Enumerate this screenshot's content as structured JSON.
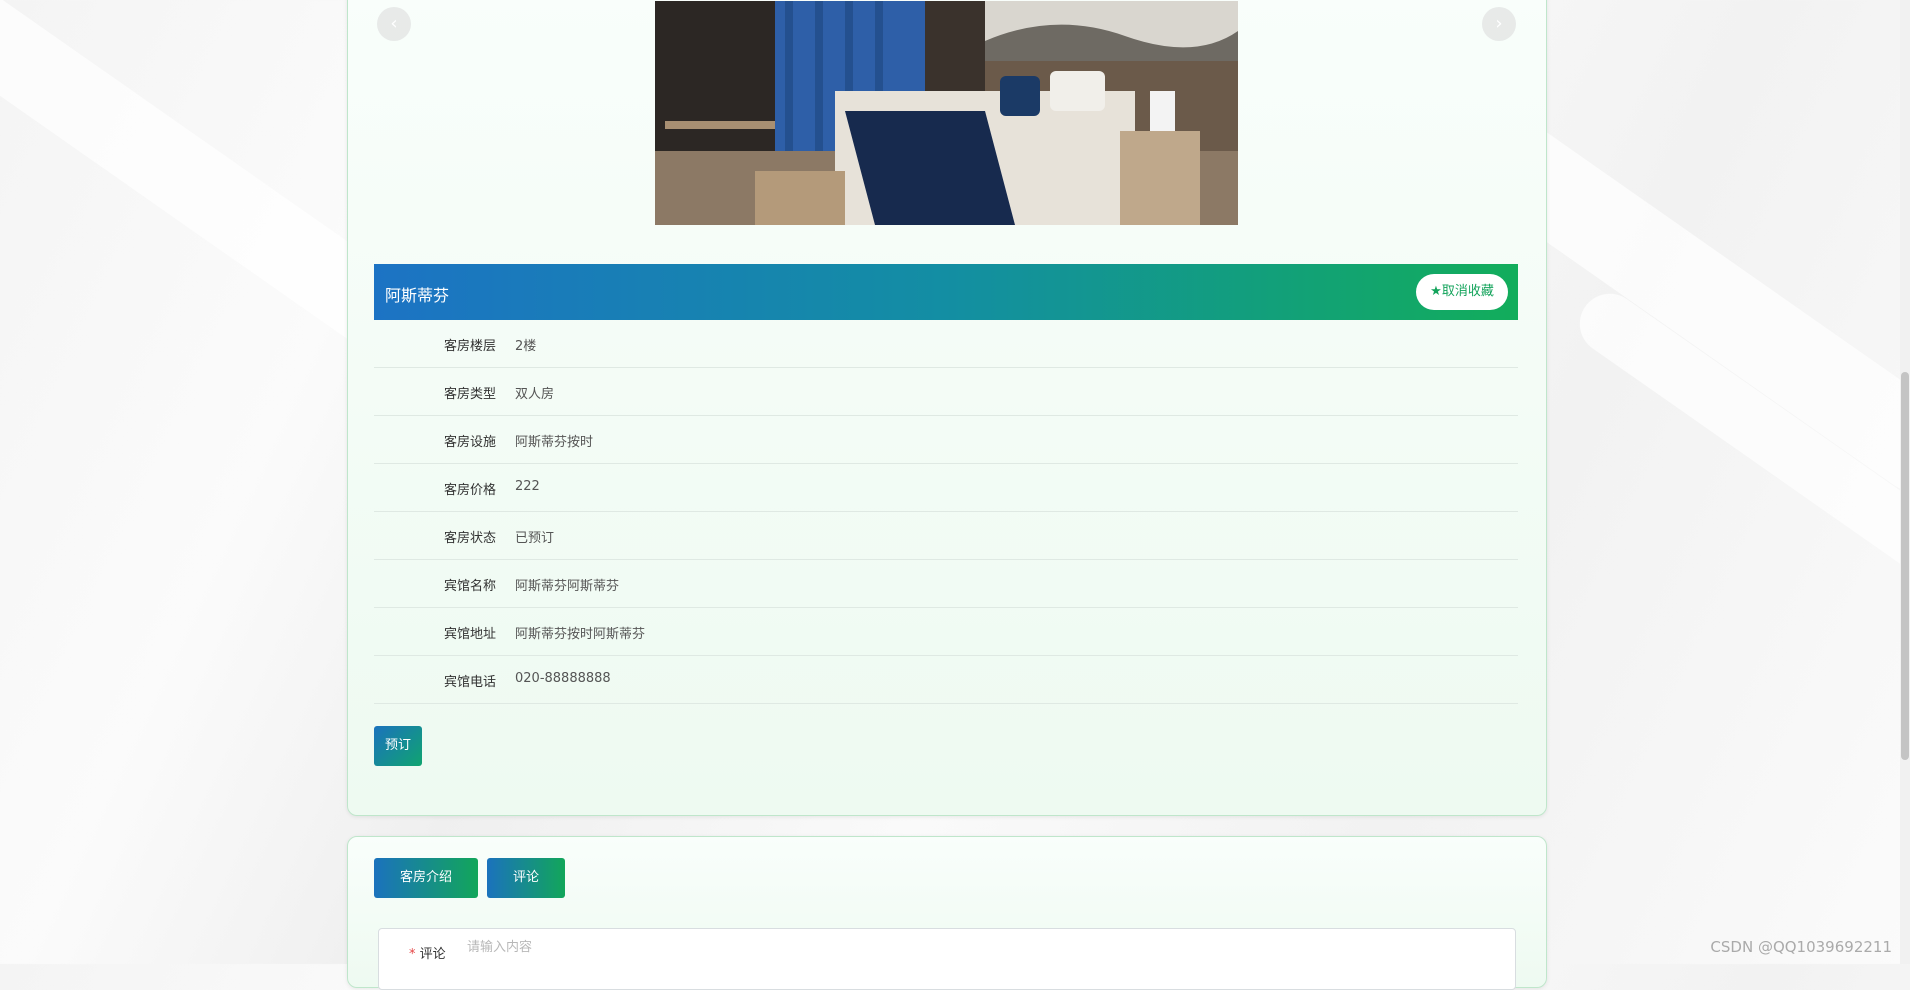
{
  "carousel": {
    "prev_icon": "chevron-left-icon",
    "next_icon": "chevron-right-icon",
    "prev_glyph": "‹",
    "next_glyph": "›"
  },
  "room": {
    "title": "阿斯蒂芬",
    "favorite_label": "★取消收藏",
    "fields": [
      {
        "label": "客房楼层",
        "value": "2楼"
      },
      {
        "label": "客房类型",
        "value": "双人房"
      },
      {
        "label": "客房设施",
        "value": "阿斯蒂芬按时"
      },
      {
        "label": "客房价格",
        "value": "222"
      },
      {
        "label": "客房状态",
        "value": "已预订"
      },
      {
        "label": "宾馆名称",
        "value": "阿斯蒂芬阿斯蒂芬"
      },
      {
        "label": "宾馆地址",
        "value": "阿斯蒂芬按时阿斯蒂芬"
      },
      {
        "label": "宾馆电话",
        "value": "020-88888888"
      }
    ],
    "book_label": "预订"
  },
  "tabs": {
    "intro_label": "客房介绍",
    "comment_label": "评论"
  },
  "comment": {
    "required_mark": "*",
    "label": "评论",
    "placeholder": "请输入内容"
  },
  "watermark": "CSDN @QQ1039692211",
  "colors": {
    "accent_blue": "#1c73c4",
    "accent_green": "#12ad5b"
  }
}
